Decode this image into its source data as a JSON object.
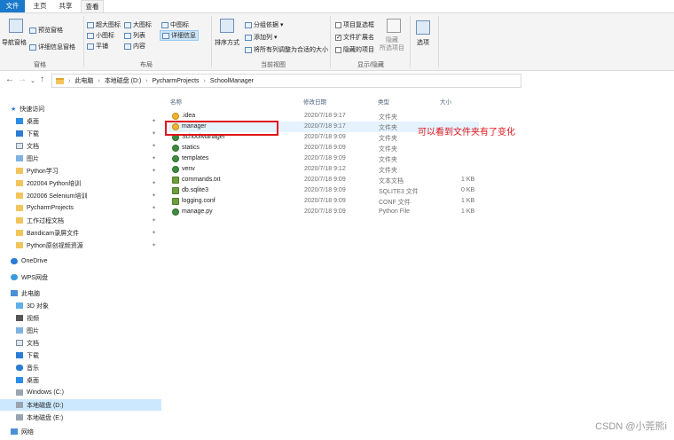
{
  "tabs": {
    "file": "文件",
    "home": "主页",
    "share": "共享",
    "view": "查看"
  },
  "ribbon": {
    "panes": {
      "nav_pane": "导航窗格",
      "preview_pane": "预览窗格",
      "details_pane": "详细信息窗格",
      "label": "窗格"
    },
    "layout": {
      "extra_large": "超大图标",
      "large": "大图标",
      "medium": "中图标",
      "small": "小图标",
      "list": "列表",
      "details": "详细信息",
      "tiles": "平铺",
      "content": "内容",
      "label": "布局"
    },
    "current_view": {
      "sort_by": "排序方式",
      "group_by": "分组依据",
      "add_columns": "添加列",
      "size_all_columns": "将所有列调整为合适的大小",
      "label": "当前视图"
    },
    "show_hide": {
      "item_checkboxes": "项目复选框",
      "file_extensions": "文件扩展名",
      "hidden_items": "隐藏的项目",
      "hide_selected": "隐藏\n所选项目",
      "label": "显示/隐藏"
    },
    "options": "选项"
  },
  "address": {
    "segments": [
      "此电脑",
      "本地磁盘 (D:)",
      "PycharmProjects",
      "SchoolManager"
    ]
  },
  "nav_pane": {
    "quick_access": "快速访问",
    "items": [
      {
        "label": "桌面"
      },
      {
        "label": "下载"
      },
      {
        "label": "文档"
      },
      {
        "label": "图片"
      },
      {
        "label": "Python学习"
      },
      {
        "label": "202004 Python培训"
      },
      {
        "label": "202006 Selenium培训"
      },
      {
        "label": "PycharmProjects"
      },
      {
        "label": "工作过程文档"
      },
      {
        "label": "Bandicam录屏文件"
      },
      {
        "label": "Python原创视频资源"
      }
    ],
    "onedrive": "OneDrive",
    "wps": "WPS网盘",
    "this_pc": "此电脑",
    "pc_items": [
      {
        "label": "3D 对象"
      },
      {
        "label": "视频"
      },
      {
        "label": "图片"
      },
      {
        "label": "文档"
      },
      {
        "label": "下载"
      },
      {
        "label": "音乐"
      },
      {
        "label": "桌面"
      },
      {
        "label": "Windows (C:)"
      },
      {
        "label": "本地磁盘 (D:)"
      },
      {
        "label": "本地磁盘 (E:)"
      }
    ],
    "network": "网络"
  },
  "columns": {
    "name": "名称",
    "modified": "修改日期",
    "type": "类型",
    "size": "大小"
  },
  "files": [
    {
      "name": ".idea",
      "date": "2020/7/18 9:17",
      "type": "文件夹",
      "size": ""
    },
    {
      "name": "manager",
      "date": "2020/7/18 9:17",
      "type": "文件夹",
      "size": ""
    },
    {
      "name": "SchoolManager",
      "date": "2020/7/18 9:09",
      "type": "文件夹",
      "size": ""
    },
    {
      "name": "statics",
      "date": "2020/7/18 9:09",
      "type": "文件夹",
      "size": ""
    },
    {
      "name": "templates",
      "date": "2020/7/18 9:09",
      "type": "文件夹",
      "size": ""
    },
    {
      "name": "venv",
      "date": "2020/7/18 9:12",
      "type": "文件夹",
      "size": ""
    },
    {
      "name": "commands.txt",
      "date": "2020/7/18 9:09",
      "type": "文本文档",
      "size": "1 KB"
    },
    {
      "name": "db.sqlite3",
      "date": "2020/7/18 9:09",
      "type": "SQLITE3 文件",
      "size": "0 KB"
    },
    {
      "name": "logging.conf",
      "date": "2020/7/18 9:09",
      "type": "CONF 文件",
      "size": "1 KB"
    },
    {
      "name": "manage.py",
      "date": "2020/7/18 9:09",
      "type": "Python File",
      "size": "1 KB"
    }
  ],
  "annotation": "可以看到文件夹有了变化",
  "watermark": "CSDN @小莞熊i"
}
